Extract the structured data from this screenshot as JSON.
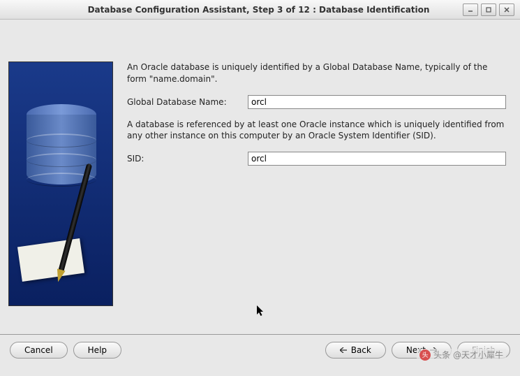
{
  "window": {
    "title": "Database Configuration Assistant, Step 3 of 12 : Database Identification"
  },
  "main": {
    "desc1": "An Oracle database is uniquely identified by a Global Database Name, typically of the form \"name.domain\".",
    "global_db_label": "Global Database Name:",
    "global_db_value": "orcl",
    "desc2": "A database is referenced by at least one Oracle instance which is uniquely identified from any other instance on this computer by an Oracle System Identifier (SID).",
    "sid_label": "SID:",
    "sid_value": "orcl"
  },
  "buttons": {
    "cancel": "Cancel",
    "help": "Help",
    "back": "Back",
    "next": "Next",
    "finish": "Finish"
  },
  "watermark": "头条 @天才小犀牛"
}
